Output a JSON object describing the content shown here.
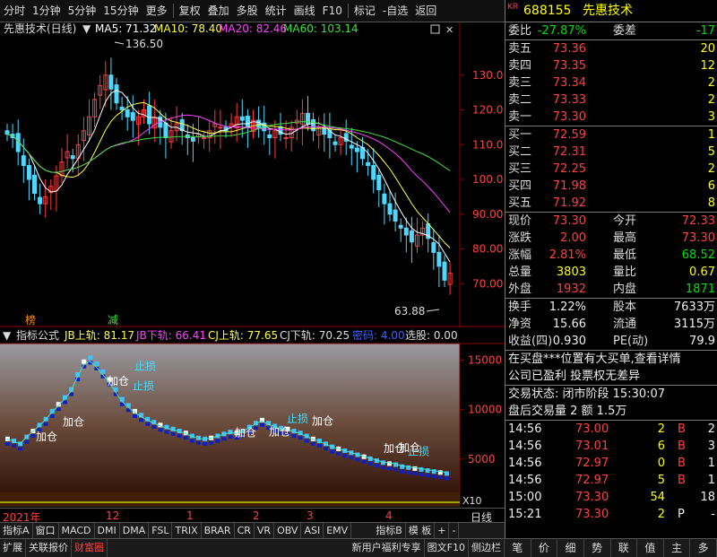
{
  "toolbar": {
    "items": [
      "分时",
      "1分钟",
      "5分钟",
      "15分钟",
      "更多",
      "复权",
      "叠加",
      "多股",
      "统计",
      "画线",
      "F10",
      "标记",
      "-自选",
      "返回"
    ]
  },
  "main_chart": {
    "stock_label": "先惠技术(日线)",
    "ma5_label": "MA5: 71.32",
    "ma10_label": "MA10: 78.40",
    "ma20_label": "MA20: 82.46",
    "ma60_label": "MA60: 103.14",
    "high_marker": "136.50",
    "low_marker": "63.88",
    "tag_bang": "榜",
    "tag_jian": "减",
    "price_ticks": [
      "130.0",
      "120.0",
      "110.0",
      "100.0",
      "90.00",
      "80.00",
      "70.00"
    ],
    "colors": {
      "up": "#ff3b3b",
      "down": "#4fd8ff",
      "ma5": "#ffffff",
      "ma10": "#ffff40",
      "ma20": "#ff40ff",
      "ma60": "#40e040"
    }
  },
  "indicator": {
    "title": "指标公式",
    "jb_up": "JB上轨: 81.17",
    "jb_down": "JB下轨: 66.41",
    "cj_up": "CJ上轨: 77.65",
    "cj_down": "CJ下轨: 70.25",
    "mima": "密码: 4.00",
    "xuandian": "选股: 0.00",
    "ticks": [
      "15000",
      "10000",
      "5000"
    ],
    "labels": [
      "加仓",
      "加仓",
      "加仓",
      "止损",
      "止损",
      "加仓",
      "加仓",
      "加仓",
      "止损",
      "加仓",
      "加仓",
      "止损"
    ],
    "x10": "X10"
  },
  "time_axis": {
    "labels": [
      "2021年",
      "12",
      "1",
      "2",
      "3",
      "4"
    ],
    "period": "日线"
  },
  "tabs": [
    "指标A",
    "窗口",
    "MACD",
    "DMI",
    "DMA",
    "FSL",
    "TRIX",
    "BRAR",
    "CR",
    "VR",
    "OBV",
    "ASI",
    "EMV",
    "指标B",
    "模 板",
    "+",
    "-"
  ],
  "statusbar": [
    "扩展",
    "关联报价",
    "财富圈",
    "新用户福利专享",
    "图文F10",
    "侧边栏"
  ],
  "quote": {
    "kr": "KR",
    "code": "688155",
    "name": "先惠技术",
    "weibi_label": "委比",
    "weibi": "-27.87%",
    "weicha_label": "委差",
    "weicha": "-17",
    "sell": [
      {
        "label": "卖五",
        "price": "73.36",
        "vol": "20"
      },
      {
        "label": "卖四",
        "price": "73.35",
        "vol": "12"
      },
      {
        "label": "卖三",
        "price": "73.34",
        "vol": "2"
      },
      {
        "label": "卖二",
        "price": "73.33",
        "vol": "2"
      },
      {
        "label": "卖一",
        "price": "73.30",
        "vol": "3"
      }
    ],
    "buy": [
      {
        "label": "买一",
        "price": "72.59",
        "vol": "1"
      },
      {
        "label": "买二",
        "price": "72.31",
        "vol": "5"
      },
      {
        "label": "买三",
        "price": "72.25",
        "vol": "2"
      },
      {
        "label": "买四",
        "price": "71.98",
        "vol": "6"
      },
      {
        "label": "买五",
        "price": "71.92",
        "vol": "8"
      }
    ],
    "stats": [
      {
        "l1": "现价",
        "v1": "73.30",
        "l2": "今开",
        "v2": "72.33",
        "c1": "red",
        "c2": "red"
      },
      {
        "l1": "涨跌",
        "v1": "2.00",
        "l2": "最高",
        "v2": "73.30",
        "c1": "red",
        "c2": "red"
      },
      {
        "l1": "涨幅",
        "v1": "2.81%",
        "l2": "最低",
        "v2": "68.52",
        "c1": "red",
        "c2": "grn"
      },
      {
        "l1": "总量",
        "v1": "3803",
        "l2": "量比",
        "v2": "0.67",
        "c1": "yel",
        "c2": "yel"
      },
      {
        "l1": "外盘",
        "v1": "1932",
        "l2": "内盘",
        "v2": "1871",
        "c1": "red",
        "c2": "grn"
      }
    ],
    "stats2": [
      {
        "l1": "换手",
        "v1": "1.22%",
        "l2": "股本",
        "v2": "7633万"
      },
      {
        "l1": "净资",
        "v1": "15.66",
        "l2": "流通",
        "v2": "3115万"
      },
      {
        "l1": "收益(四)",
        "v1": "0.930",
        "l2": "PE(动)",
        "v2": "79.9"
      }
    ],
    "news1": "在买盘***位置有大买单,查看详情",
    "news2": "公司已盈利 投票权无差异",
    "status_line": "交易状态: 闭市阶段 15:30:07",
    "after_hours": "盘后交易量 2 额 1.5万",
    "ticks": [
      {
        "t": "14:56",
        "p": "73.00",
        "v": "2",
        "bs": "B",
        "n": "2"
      },
      {
        "t": "14:56",
        "p": "73.01",
        "v": "6",
        "bs": "B",
        "n": "3"
      },
      {
        "t": "14:56",
        "p": "72.97",
        "v": "0",
        "bs": "B",
        "n": "1"
      },
      {
        "t": "14:56",
        "p": "72.97",
        "v": "5",
        "bs": "B",
        "n": "1"
      },
      {
        "t": "15:00",
        "p": "73.30",
        "v": "54",
        "bs": "",
        "n": "18"
      },
      {
        "t": "15:21",
        "p": "73.30",
        "v": "2",
        "bs": "P",
        "n": "-"
      }
    ],
    "bottom_tabs": [
      "笔",
      "价",
      "细",
      "势",
      "联",
      "值",
      "主",
      "多"
    ]
  }
}
